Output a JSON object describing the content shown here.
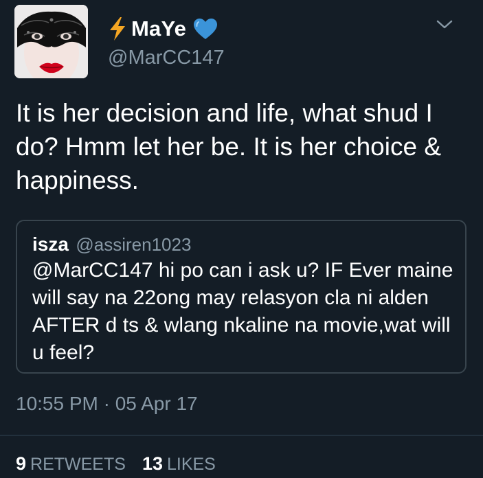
{
  "author": {
    "display_name": "MaYe",
    "handle": "@MarCC147",
    "name_prefix_icon": "lightning-bolt-icon",
    "name_suffix_icon": "blue-heart-icon",
    "avatar": "masked-face-avatar"
  },
  "menu_icon": "chevron-down-icon",
  "tweet": {
    "text": "It is her decision and life, what shud I do? Hmm let her be. It is her choice & happiness.",
    "timestamp": "10:55 PM · 05 Apr 17"
  },
  "quoted_tweet": {
    "display_name": "isza",
    "handle": "@assiren1023",
    "text": "@MarCC147 hi po can i ask u? IF Ever maine will say na 22ong may relasyon cla ni alden AFTER d ts & wlang nkaline na movie,wat will u feel?"
  },
  "stats": {
    "retweets_count": "9",
    "retweets_label": "RETWEETS",
    "likes_count": "13",
    "likes_label": "LIKES"
  },
  "colors": {
    "background": "#141d26",
    "text_primary": "#ffffff",
    "text_secondary": "#8899a6",
    "border": "#38444d",
    "bolt": "#f5a623",
    "heart": "#3b94d9",
    "lipstick": "#d0021b"
  }
}
